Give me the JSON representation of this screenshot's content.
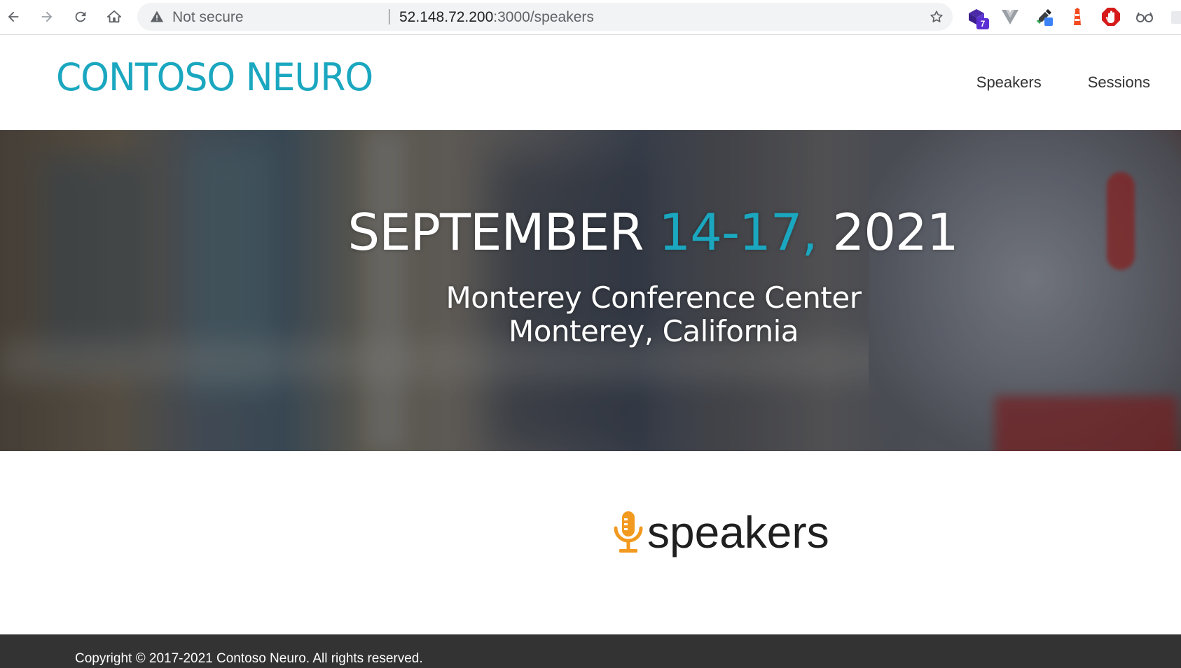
{
  "browser": {
    "security_label": "Not secure",
    "url_host": "52.148.72.200",
    "url_path": ":3000/speakers",
    "extension_badge": "7"
  },
  "site": {
    "logo": "CONTOSO NEURO",
    "nav": [
      {
        "label": "Speakers"
      },
      {
        "label": "Sessions"
      }
    ]
  },
  "hero": {
    "date_month": "SEPTEMBER",
    "date_days": "14-17,",
    "date_year": "2021",
    "venue_line1": "Monterey Conference Center",
    "venue_line2": "Monterey, California"
  },
  "main": {
    "section_title": "speakers",
    "section_icon": "microphone-icon"
  },
  "footer": {
    "copyright": "Copyright © 2017-2021 Contoso Neuro. All rights reserved."
  },
  "colors": {
    "brand_teal": "#1aa7bf",
    "mic_orange": "#f29a1f",
    "footer_bg": "#333333"
  }
}
